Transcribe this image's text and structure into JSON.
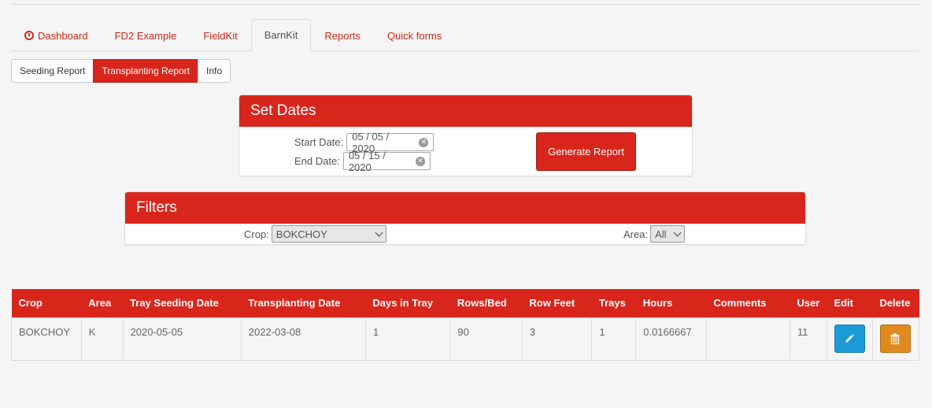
{
  "tabs": [
    {
      "label": "Dashboard"
    },
    {
      "label": "FD2 Example"
    },
    {
      "label": "FieldKit"
    },
    {
      "label": "BarnKit"
    },
    {
      "label": "Reports"
    },
    {
      "label": "Quick forms"
    }
  ],
  "subtabs": [
    {
      "label": "Seeding Report"
    },
    {
      "label": "Transplanting Report"
    },
    {
      "label": "Info"
    }
  ],
  "dates_panel": {
    "title": "Set Dates",
    "start_label": "Start Date:",
    "start_value": "05 / 05 / 2020",
    "end_label": "End Date:",
    "end_value": "05 / 15 / 2020",
    "generate_label": "Generate Report"
  },
  "filters_panel": {
    "title": "Filters",
    "crop_label": "Crop:",
    "crop_value": "BOKCHOY",
    "area_label": "Area:",
    "area_value": "All"
  },
  "table": {
    "headers": [
      "Crop",
      "Area",
      "Tray Seeding Date",
      "Transplanting Date",
      "Days in Tray",
      "Rows/Bed",
      "Row Feet",
      "Trays",
      "Hours",
      "Comments",
      "User",
      "Edit",
      "Delete"
    ],
    "rows": [
      [
        "BOKCHOY",
        "K",
        "2020-05-05",
        "2022-03-08",
        "1",
        "90",
        "3",
        "1",
        "0.0166667",
        "",
        "11"
      ]
    ]
  },
  "colors": {
    "accent": "#d9261c",
    "edit": "#1a9ad6",
    "delete": "#e08a1e"
  }
}
